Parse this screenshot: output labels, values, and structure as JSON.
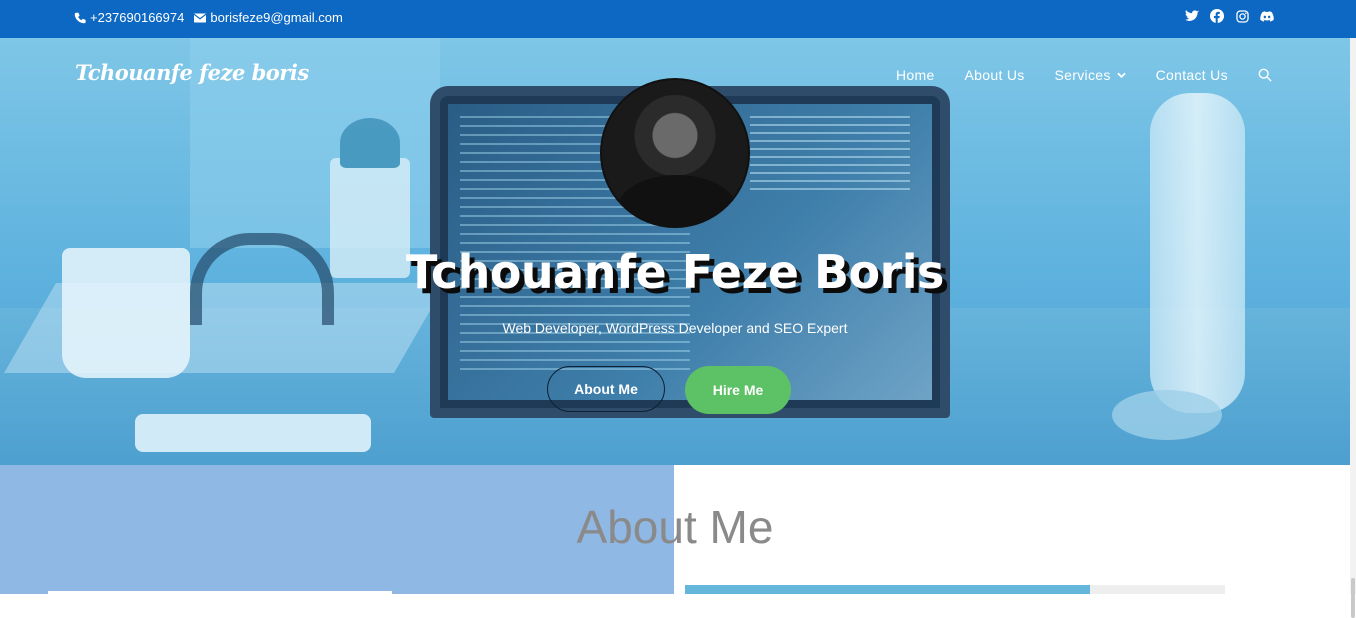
{
  "topbar": {
    "phone": "+237690166974",
    "email": "borisfeze9@gmail.com",
    "social_icons": [
      "twitter-icon",
      "facebook-icon",
      "instagram-icon",
      "discord-icon"
    ]
  },
  "header": {
    "logo": "Tchouanfe feze boris",
    "nav": {
      "home": "Home",
      "about": "About Us",
      "services": "Services",
      "contact": "Contact Us"
    }
  },
  "hero": {
    "name": "Tchouanfe Feze Boris",
    "subtitle": "Web Developer, WordPress Developer and SEO Expert",
    "about_button": "About Me",
    "hire_button": "Hire Me"
  },
  "about": {
    "title": "About Me",
    "progress": 0.75
  },
  "colors": {
    "topbar": "#0d68c3",
    "hire_button": "#5dc265",
    "about_left_bg": "#8fb8e4"
  }
}
